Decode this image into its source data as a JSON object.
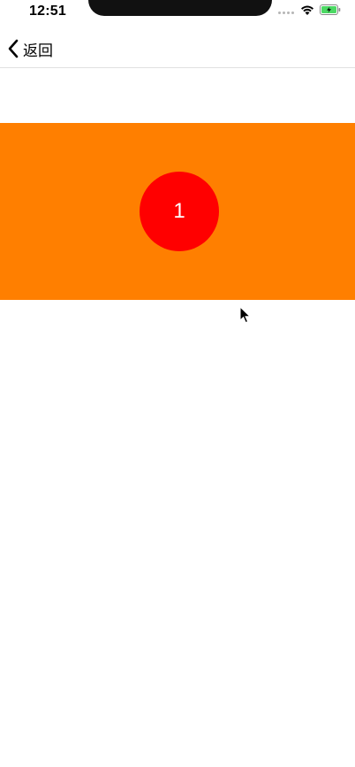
{
  "status_bar": {
    "time": "12:51",
    "icons": [
      "signal-dots-icon",
      "wifi-icon",
      "battery-charging-icon"
    ]
  },
  "nav_bar": {
    "back_label": "返回",
    "back_icon": "chevron-left-icon"
  },
  "banner": {
    "background_color": "#ff7f00",
    "circle_color": "#ff0000",
    "circle_text": "1"
  },
  "cursor": {
    "icon": "mouse-pointer-icon"
  }
}
